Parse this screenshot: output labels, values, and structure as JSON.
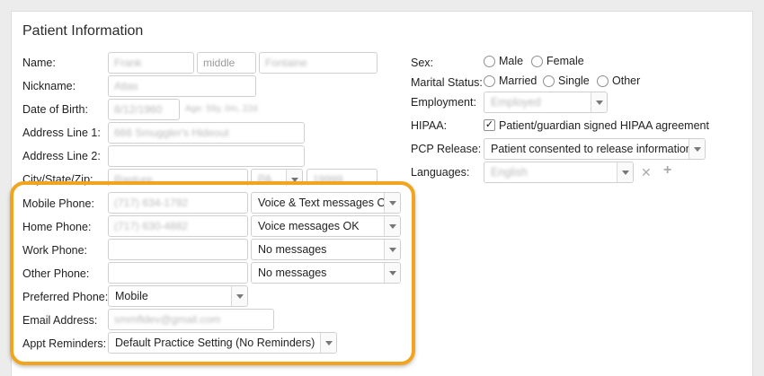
{
  "form": {
    "title": "Patient Information",
    "name": {
      "label": "Name:",
      "first": "Frank",
      "middle_placeholder": "middle",
      "last": "Fontaine"
    },
    "nickname": {
      "label": "Nickname:",
      "value": "Atlas"
    },
    "dob": {
      "label": "Date of Birth:",
      "value": "8/12/1960",
      "age": "Age: 59y, 0m, 22d"
    },
    "address1": {
      "label": "Address Line 1:",
      "value": "666 Smuggler's Hideout"
    },
    "address2": {
      "label": "Address Line 2:",
      "value": ""
    },
    "city_state_zip": {
      "label": "City/State/Zip:",
      "city": "Rapture",
      "state": "PA",
      "zip": "19999"
    },
    "mobile_phone": {
      "label": "Mobile Phone:",
      "value": "(717) 634-1792",
      "option": "Voice & Text messages OK"
    },
    "home_phone": {
      "label": "Home Phone:",
      "value": "(717) 630-4882",
      "option": "Voice messages OK"
    },
    "work_phone": {
      "label": "Work Phone:",
      "value": "",
      "option": "No messages"
    },
    "other_phone": {
      "label": "Other Phone:",
      "value": "",
      "option": "No messages"
    },
    "preferred_phone": {
      "label": "Preferred Phone:",
      "value": "Mobile"
    },
    "email": {
      "label": "Email Address:",
      "value": "smmfldev@gmail.com"
    },
    "appt_reminders": {
      "label": "Appt Reminders:",
      "value": "Default Practice Setting (No Reminders)"
    }
  },
  "right": {
    "sex": {
      "label": "Sex:",
      "options": [
        "Male",
        "Female"
      ]
    },
    "marital": {
      "label": "Marital Status:",
      "options": [
        "Married",
        "Single",
        "Other"
      ]
    },
    "employment": {
      "label": "Employment:",
      "value": "Employed"
    },
    "hipaa": {
      "label": "HIPAA:",
      "checkbox_label": "Patient/guardian signed HIPAA agreement",
      "checked": true
    },
    "pcp_release": {
      "label": "PCP Release:",
      "value": "Patient consented to release information"
    },
    "languages": {
      "label": "Languages:",
      "value": "English"
    }
  },
  "colors": {
    "highlight": "#f1a51f"
  }
}
